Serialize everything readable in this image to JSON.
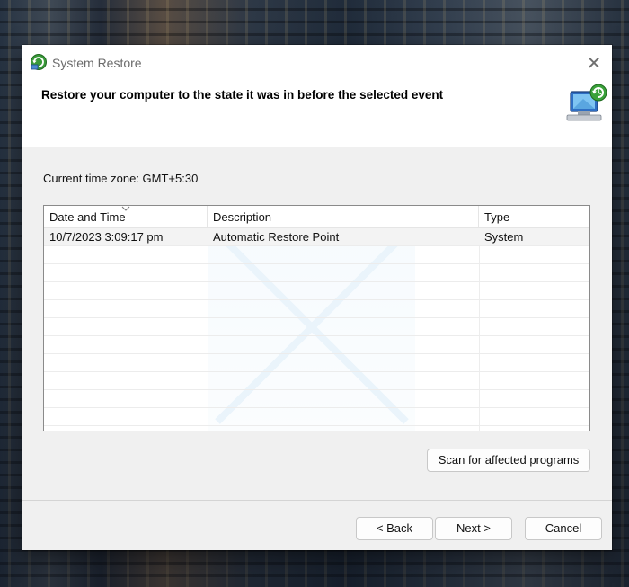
{
  "window": {
    "title": "System Restore",
    "close_glyph": "✕"
  },
  "header": {
    "heading": "Restore your computer to the state it was in before the selected event",
    "icon": "system-restore-computer-icon"
  },
  "timezone_label": "Current time zone: GMT+5:30",
  "restore_points": {
    "columns": [
      "Date and Time",
      "Description",
      "Type"
    ],
    "sorted_column": "Date and Time",
    "rows": [
      {
        "date_time": "10/7/2023 3:09:17 pm",
        "description": "Automatic Restore Point",
        "type": "System"
      }
    ]
  },
  "buttons": {
    "scan": "Scan for affected programs",
    "back": "< Back",
    "next": "Next >",
    "cancel": "Cancel"
  },
  "colors": {
    "dialog_bg": "#f0f0f0",
    "header_bg": "#ffffff",
    "row_selected_bg": "#f3f3f3"
  }
}
